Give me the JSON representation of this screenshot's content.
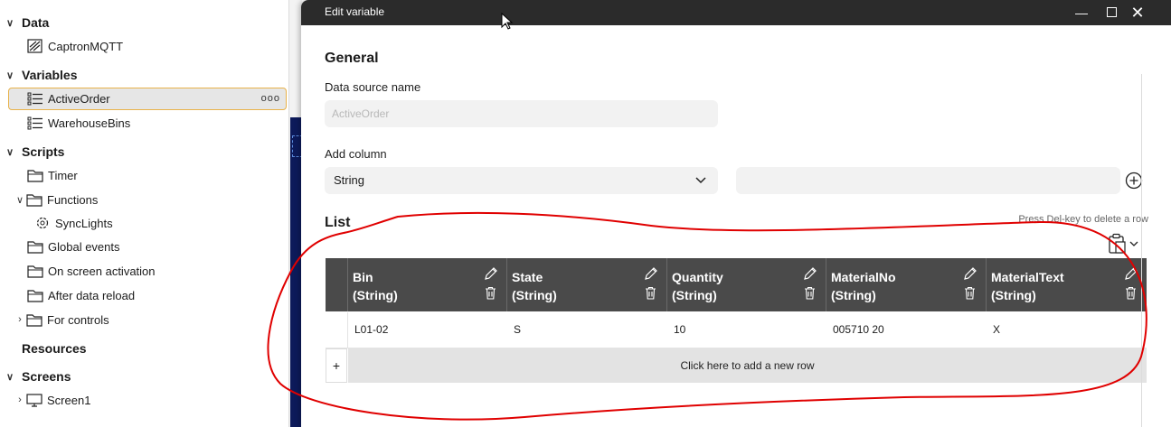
{
  "tree": {
    "sections": {
      "data": "Data",
      "variables": "Variables",
      "scripts": "Scripts",
      "resources": "Resources",
      "screens": "Screens"
    },
    "items": {
      "captron": "CaptronMQTT",
      "active_order": "ActiveOrder",
      "warehouse_bins": "WarehouseBins",
      "timer": "Timer",
      "functions": "Functions",
      "sync_lights": "SyncLights",
      "global_events": "Global events",
      "on_screen_activation": "On screen activation",
      "after_data_reload": "After data reload",
      "for_controls": "For controls",
      "screen1": "Screen1"
    },
    "more_menu": "ooo"
  },
  "dialog": {
    "title": "Edit variable",
    "general_heading": "General",
    "data_source_label": "Data source name",
    "data_source_value": "ActiveOrder",
    "add_column_label": "Add column",
    "add_column_type": "String",
    "add_column_name": "",
    "list_heading": "List",
    "hint": "Press Del-key to delete a row",
    "columns": [
      {
        "name": "Bin",
        "type": "(String)"
      },
      {
        "name": "State",
        "type": "(String)"
      },
      {
        "name": "Quantity",
        "type": "(String)"
      },
      {
        "name": "MaterialNo",
        "type": "(String)"
      },
      {
        "name": "MaterialText",
        "type": "(String)"
      }
    ],
    "rows": [
      [
        "L01-02",
        "S",
        "10",
        "005710 20",
        "X"
      ]
    ],
    "add_row_plus": "+",
    "add_row_text": "Click here to add a new row"
  },
  "colors": {
    "titlebar": "#2b2b2b",
    "grid_header": "#4a4a4a",
    "selection_border": "#e8b24a",
    "annotation": "#e00000"
  },
  "icons": [
    "folder-icon",
    "variable-list-icon",
    "data-source-icon",
    "script-icon",
    "screen-icon",
    "pencil-icon",
    "trash-icon",
    "clipboard-icon",
    "plus-circle-icon",
    "chevron-down-icon"
  ]
}
